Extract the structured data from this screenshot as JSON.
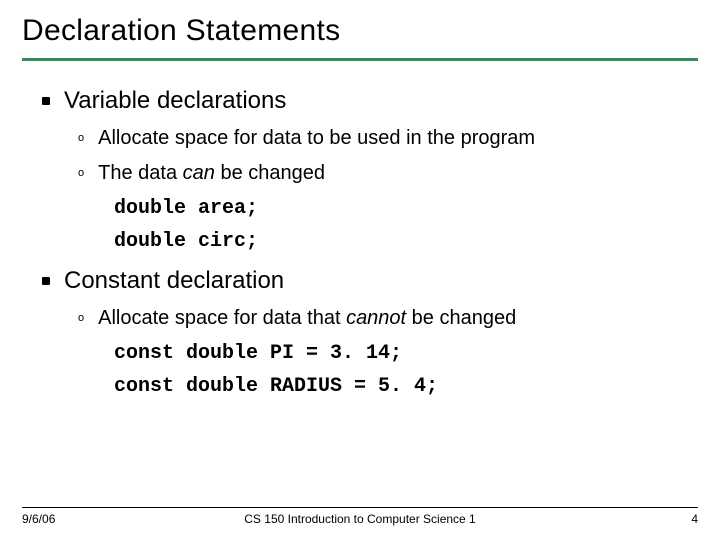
{
  "title": "Declaration Statements",
  "sections": [
    {
      "heading": "Variable declarations",
      "items": [
        {
          "html": "Allocate space for data to be used in the program"
        },
        {
          "html": "The data <em>can</em> be changed"
        }
      ],
      "code": [
        "double area;",
        "double circ;"
      ]
    },
    {
      "heading": "Constant declaration",
      "items": [
        {
          "html": "Allocate space for data that <em>cannot</em> be changed"
        }
      ],
      "code": [
        "const double PI = 3. 14;",
        "const double RADIUS = 5. 4;"
      ]
    }
  ],
  "footer": {
    "date": "9/6/06",
    "course": "CS 150 Introduction to Computer Science 1",
    "page": "4"
  },
  "chart_data": null
}
